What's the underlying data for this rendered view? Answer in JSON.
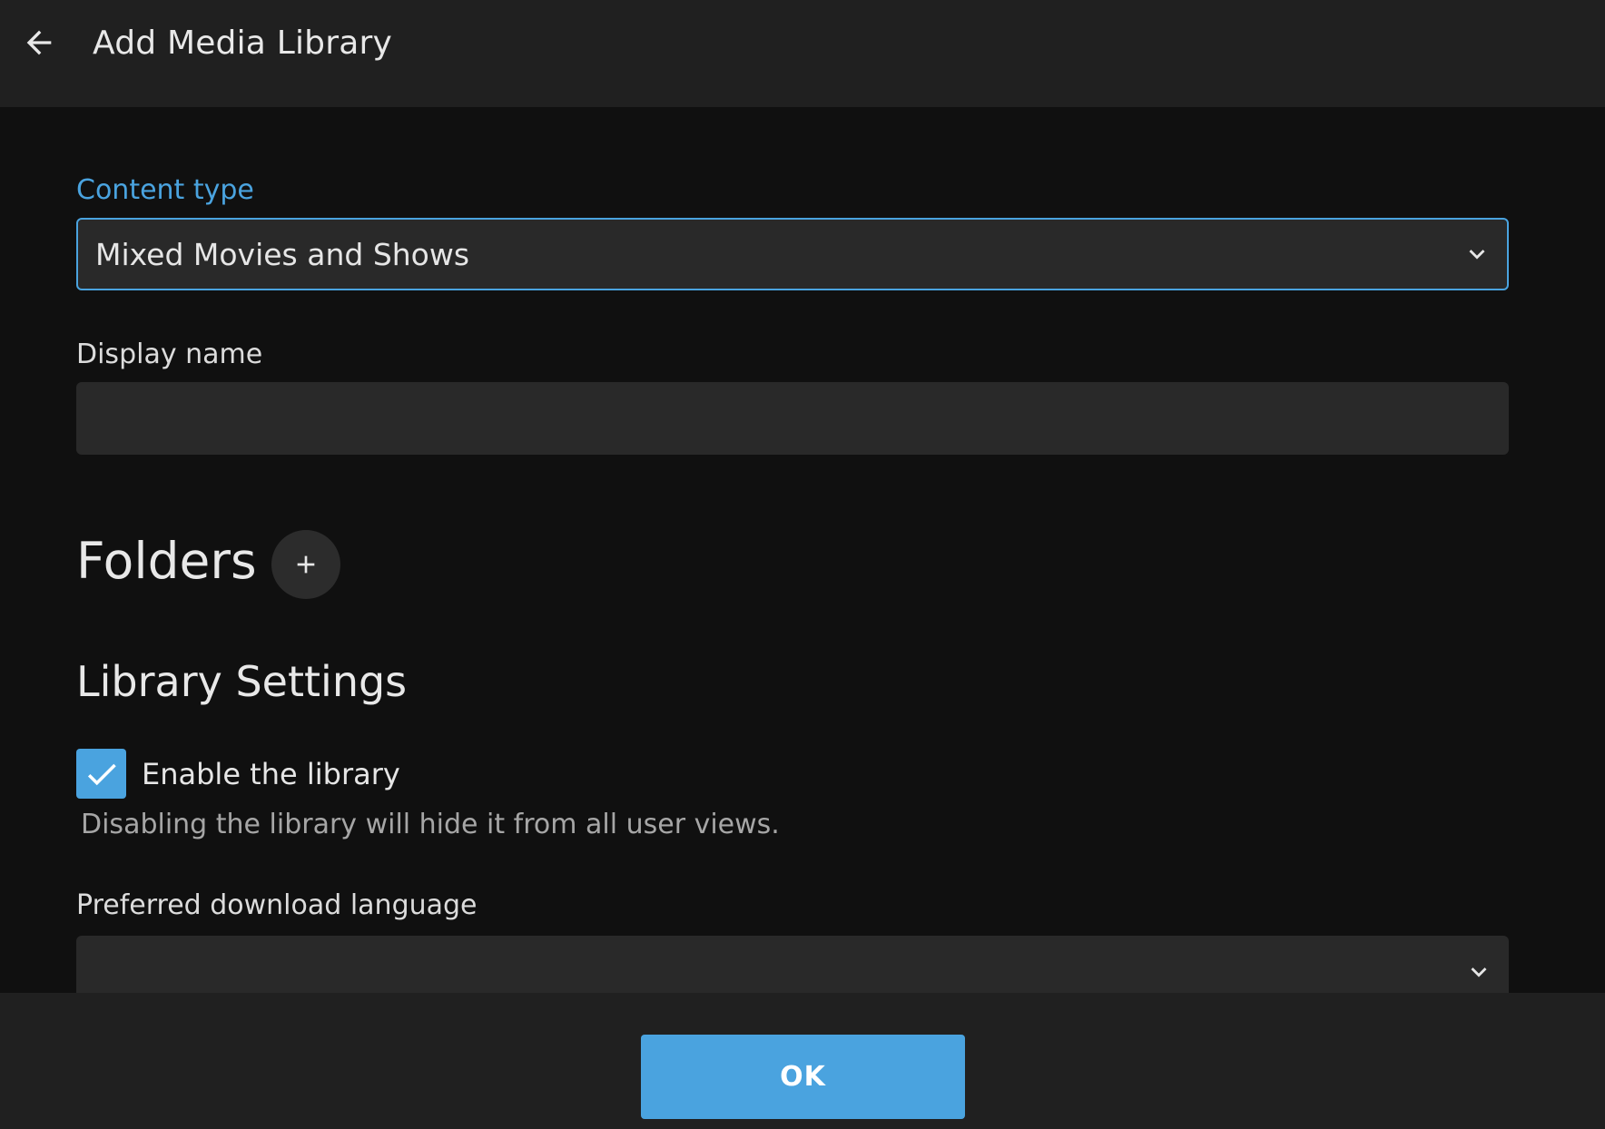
{
  "header": {
    "title": "Add Media Library",
    "back_icon": "arrow-left-icon"
  },
  "form": {
    "content_type": {
      "label": "Content type",
      "value": "Mixed Movies and Shows",
      "icon": "chevron-down-icon",
      "focused": true
    },
    "display_name": {
      "label": "Display name",
      "value": "",
      "placeholder": ""
    },
    "folders": {
      "title": "Folders",
      "add_icon": "plus-icon"
    },
    "library_settings": {
      "title": "Library Settings",
      "enable_library": {
        "label": "Enable the library",
        "checked": true,
        "help": "Disabling the library will hide it from all user views."
      },
      "preferred_download_language": {
        "label": "Preferred download language",
        "value": "",
        "icon": "chevron-down-icon"
      }
    }
  },
  "footer": {
    "ok_label": "OK"
  },
  "colors": {
    "accent": "#4aa3df",
    "background": "#101010",
    "surface": "#202020",
    "field": "#292929"
  }
}
